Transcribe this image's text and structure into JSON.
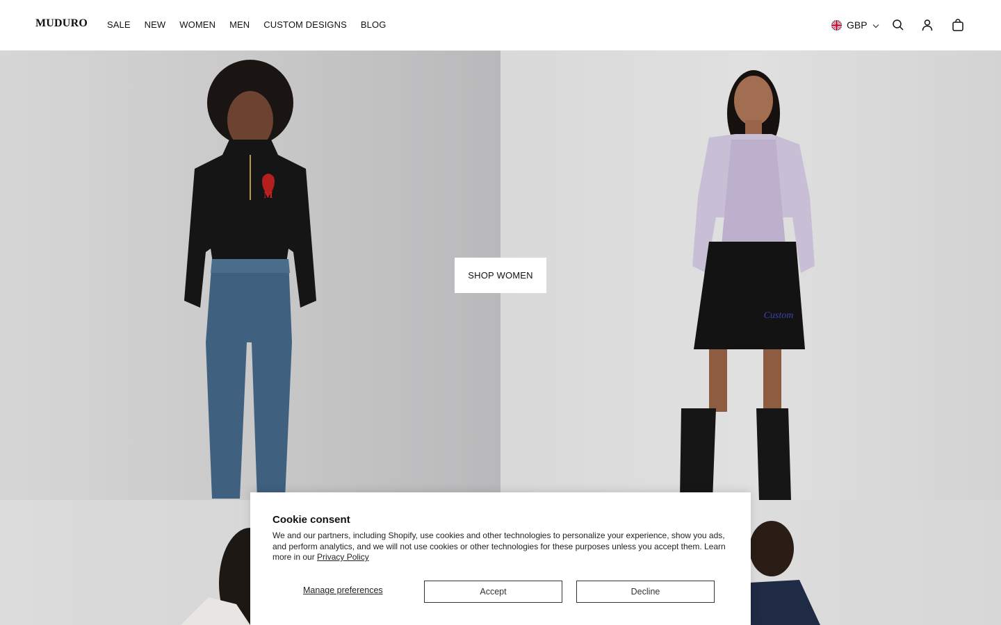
{
  "header": {
    "logo": "MUDURO",
    "nav": [
      "SALE",
      "NEW",
      "WOMEN",
      "MEN",
      "CUSTOM DESIGNS",
      "BLOG"
    ],
    "currency": "GBP"
  },
  "hero": {
    "button_label": "SHOP WOMEN"
  },
  "cookie": {
    "title": "Cookie consent",
    "body": "We and our partners, including Shopify, use cookies and other technologies to personalize your experience, show you ads, and perform analytics, and we will not use cookies or other technologies for these purposes unless you accept them. Learn more in our ",
    "policy_link": "Privacy Policy",
    "manage_label": "Manage preferences",
    "accept_label": "Accept",
    "decline_label": "Decline"
  },
  "colors": {
    "background": "#ffffff",
    "text": "#111111",
    "button_border": "#333333"
  }
}
